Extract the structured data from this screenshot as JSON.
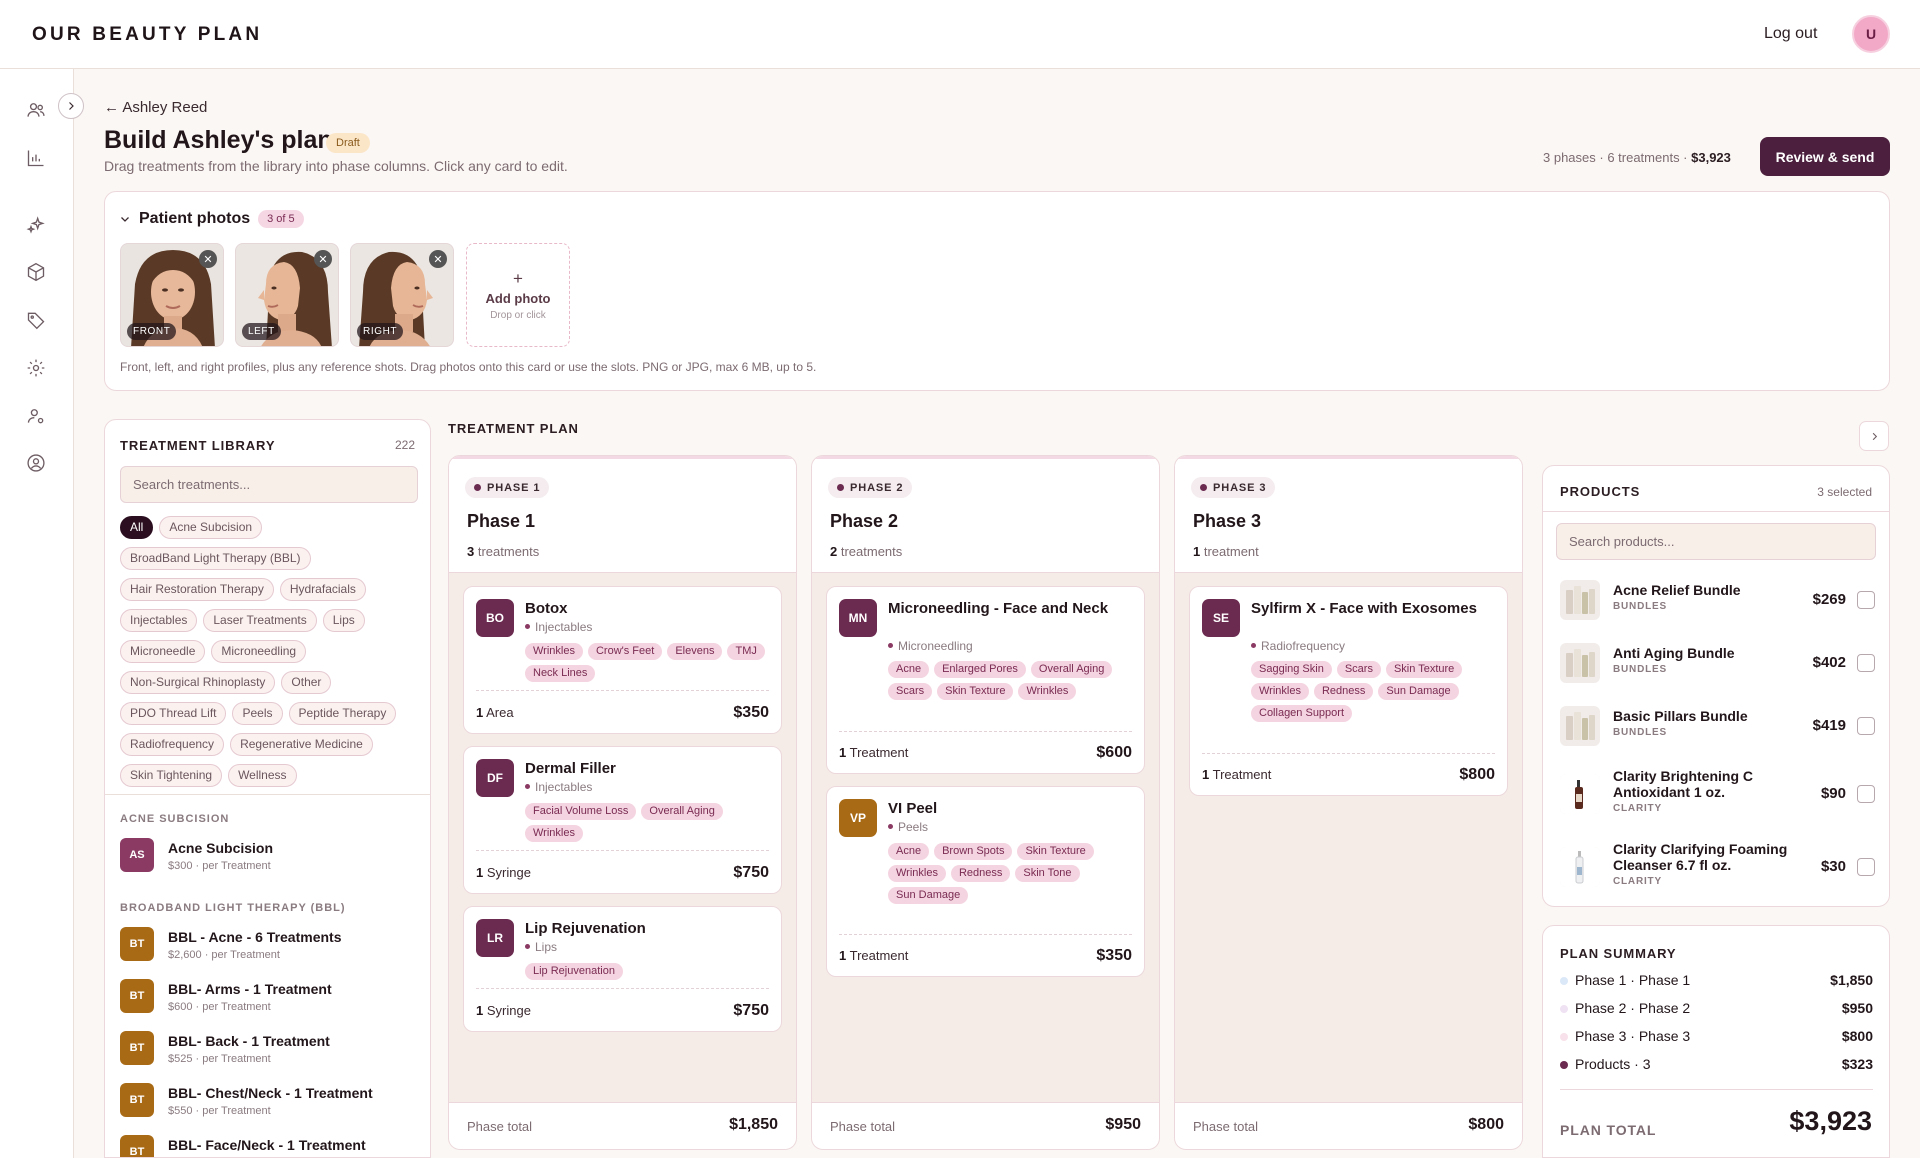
{
  "brand": "OUR BEAUTY PLAN",
  "header": {
    "logout": "Log out",
    "avatar_initial": "U"
  },
  "sidebar": {
    "icons": [
      "users-icon",
      "chart-icon",
      "sparkle-icon",
      "box-icon",
      "tag-icon",
      "gear-icon",
      "user-settings-icon",
      "user-circle-icon"
    ]
  },
  "breadcrumb": {
    "back": "← Ashley Reed"
  },
  "page": {
    "title": "Build Ashley's plan",
    "status_badge": "Draft",
    "subtitle": "Drag treatments from the library into phase columns. Click any card to edit.",
    "stats_prefix": "3 phases · 6 treatments · ",
    "stats_total": "$3,923",
    "review_button": "Review & send"
  },
  "photos": {
    "title": "Patient photos",
    "count": "3 of 5",
    "items": [
      {
        "label": "FRONT"
      },
      {
        "label": "LEFT"
      },
      {
        "label": "RIGHT"
      }
    ],
    "add_label": "Add photo",
    "add_hint": "Drop or click",
    "note": "Front, left, and right profiles, plus any reference shots. Drag photos onto this card or use the slots. PNG or JPG, max 6 MB, up to 5."
  },
  "library": {
    "title": "TREATMENT LIBRARY",
    "count": "222",
    "search_placeholder": "Search treatments...",
    "filters": [
      "All",
      "Acne Subcision",
      "BroadBand Light Therapy (BBL)",
      "Hair Restoration Therapy",
      "Hydrafacials",
      "Injectables",
      "Laser Treatments",
      "Lips",
      "Microneedle",
      "Microneedling",
      "Non-Surgical Rhinoplasty",
      "Other",
      "PDO Thread Lift",
      "Peels",
      "Peptide Therapy",
      "Radiofrequency",
      "Regenerative Medicine",
      "Skin Tightening",
      "Wellness"
    ],
    "active_filter": "All",
    "categories": [
      {
        "name": "ACNE SUBCISION",
        "items": [
          {
            "initials": "AS",
            "name": "Acne Subcision",
            "price": "$300 · per Treatment",
            "color": "#8a3a63"
          }
        ]
      },
      {
        "name": "BROADBAND LIGHT THERAPY (BBL)",
        "items": [
          {
            "initials": "BT",
            "name": "BBL - Acne - 6 Treatments",
            "price": "$2,600 · per Treatment",
            "color": "#a86a14"
          },
          {
            "initials": "BT",
            "name": "BBL- Arms - 1 Treatment",
            "price": "$600 · per Treatment",
            "color": "#a86a14"
          },
          {
            "initials": "BT",
            "name": "BBL- Back - 1 Treatment",
            "price": "$525 · per Treatment",
            "color": "#a86a14"
          },
          {
            "initials": "BT",
            "name": "BBL- Chest/Neck - 1 Treatment",
            "price": "$550 · per Treatment",
            "color": "#a86a14"
          },
          {
            "initials": "BT",
            "name": "BBL- Face/Neck - 1 Treatment",
            "price": "",
            "color": "#a86a14"
          }
        ]
      }
    ]
  },
  "plan": {
    "title": "TREATMENT PLAN",
    "phases": [
      {
        "tag": "PHASE 1",
        "name": "Phase 1",
        "count_num": "3",
        "count_label": " treatments",
        "total_label": "Phase total",
        "total": "$1,850",
        "treatments": [
          {
            "initials": "BO",
            "name": "Botox",
            "category": "Injectables",
            "tags": [
              "Wrinkles",
              "Crow's Feet",
              "Elevens",
              "TMJ",
              "Neck Lines"
            ],
            "qty_num": "1",
            "qty_unit": " Area",
            "price": "$350",
            "color": "#6b2a4f"
          },
          {
            "initials": "DF",
            "name": "Dermal Filler",
            "category": "Injectables",
            "tags": [
              "Facial Volume Loss",
              "Overall Aging",
              "Wrinkles"
            ],
            "qty_num": "1",
            "qty_unit": " Syringe",
            "price": "$750",
            "color": "#6b2a4f"
          },
          {
            "initials": "LR",
            "name": "Lip Rejuvenation",
            "category": "Lips",
            "tags": [
              "Lip Rejuvenation"
            ],
            "qty_num": "1",
            "qty_unit": " Syringe",
            "price": "$750",
            "color": "#6b2a4f"
          }
        ]
      },
      {
        "tag": "PHASE 2",
        "name": "Phase 2",
        "count_num": "2",
        "count_label": " treatments",
        "total_label": "Phase total",
        "total": "$950",
        "treatments": [
          {
            "initials": "MN",
            "name": "Microneedling - Face and Neck",
            "category": "Microneedling",
            "tags": [
              "Acne",
              "Enlarged Pores",
              "Overall Aging",
              "Scars",
              "Skin Texture",
              "Wrinkles"
            ],
            "qty_num": "1",
            "qty_unit": " Treatment",
            "price": "$600",
            "color": "#6b2a4f"
          },
          {
            "initials": "VP",
            "name": "VI Peel",
            "category": "Peels",
            "tags": [
              "Acne",
              "Brown Spots",
              "Skin Texture",
              "Wrinkles",
              "Redness",
              "Skin Tone",
              "Sun Damage"
            ],
            "qty_num": "1",
            "qty_unit": " Treatment",
            "price": "$350",
            "color": "#a86a14"
          }
        ]
      },
      {
        "tag": "PHASE 3",
        "name": "Phase 3",
        "count_num": "1",
        "count_label": " treatment",
        "total_label": "Phase total",
        "total": "$800",
        "treatments": [
          {
            "initials": "SE",
            "name": "Sylfirm X - Face with Exosomes",
            "category": "Radiofrequency",
            "tags": [
              "Sagging Skin",
              "Scars",
              "Skin Texture",
              "Wrinkles",
              "Redness",
              "Sun Damage",
              "Collagen Support"
            ],
            "qty_num": "1",
            "qty_unit": " Treatment",
            "price": "$800",
            "color": "#6b2a4f"
          }
        ]
      }
    ]
  },
  "products": {
    "title": "PRODUCTS",
    "selected": "3 selected",
    "search_placeholder": "Search products...",
    "items": [
      {
        "name": "Acne Relief Bundle",
        "brand": "BUNDLES",
        "price": "$269"
      },
      {
        "name": "Anti Aging Bundle",
        "brand": "BUNDLES",
        "price": "$402"
      },
      {
        "name": "Basic Pillars Bundle",
        "brand": "BUNDLES",
        "price": "$419"
      },
      {
        "name": "Clarity Brightening C Antioxidant 1 oz.",
        "brand": "CLARITY",
        "price": "$90"
      },
      {
        "name": "Clarity Clarifying Foaming Cleanser 6.7 fl oz.",
        "brand": "CLARITY",
        "price": "$30"
      }
    ]
  },
  "summary": {
    "title": "PLAN SUMMARY",
    "rows": [
      {
        "label": "Phase 1 · Phase 1",
        "value": "$1,850",
        "dot": "#dbe8f7"
      },
      {
        "label": "Phase 2 · Phase 2",
        "value": "$950",
        "dot": "#efe2f2"
      },
      {
        "label": "Phase 3 · Phase 3",
        "value": "$800",
        "dot": "#f8e1ea"
      },
      {
        "label": "Products · 3",
        "value": "$323",
        "dot": "#6b2a4f"
      }
    ],
    "total_label": "PLAN TOTAL",
    "total": "$3,923"
  },
  "colors": {
    "accent": "#4b1f3d",
    "tag_bg": "#f4d4e0",
    "tag_text": "#7a2b52",
    "background": "#fbf7f4"
  }
}
